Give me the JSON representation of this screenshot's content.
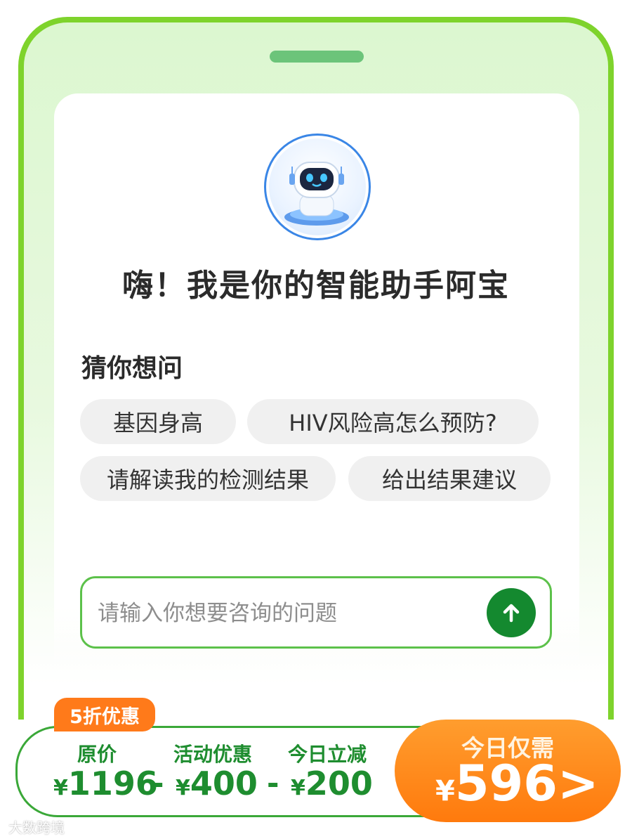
{
  "assistant": {
    "greeting": "嗨！我是你的智能助手阿宝",
    "avatar_icon": "robot-avatar"
  },
  "suggestions": {
    "title": "猜你想问",
    "items": [
      "基因身高",
      "HIV风险高怎么预防?",
      "请解读我的检测结果",
      "给出结果建议"
    ]
  },
  "input": {
    "placeholder": "请输入你想要咨询的问题",
    "value": "",
    "send_icon": "arrow-up-icon"
  },
  "pricing": {
    "badge": "5折优惠",
    "original_label": "原价",
    "original_value": "1196",
    "discount_label": "活动优惠",
    "discount_value": "400",
    "today_label": "今日立减",
    "today_value": "200",
    "currency": "¥",
    "minus": "-",
    "buy_label": "今日仅需",
    "final_price": "596",
    "buy_arrow": ">"
  },
  "watermark": "大数跨境",
  "colors": {
    "frame": "#7ed32c",
    "accent_green": "#1e8d2f",
    "send_button": "#14892f",
    "orange": "#ff7a1a"
  }
}
